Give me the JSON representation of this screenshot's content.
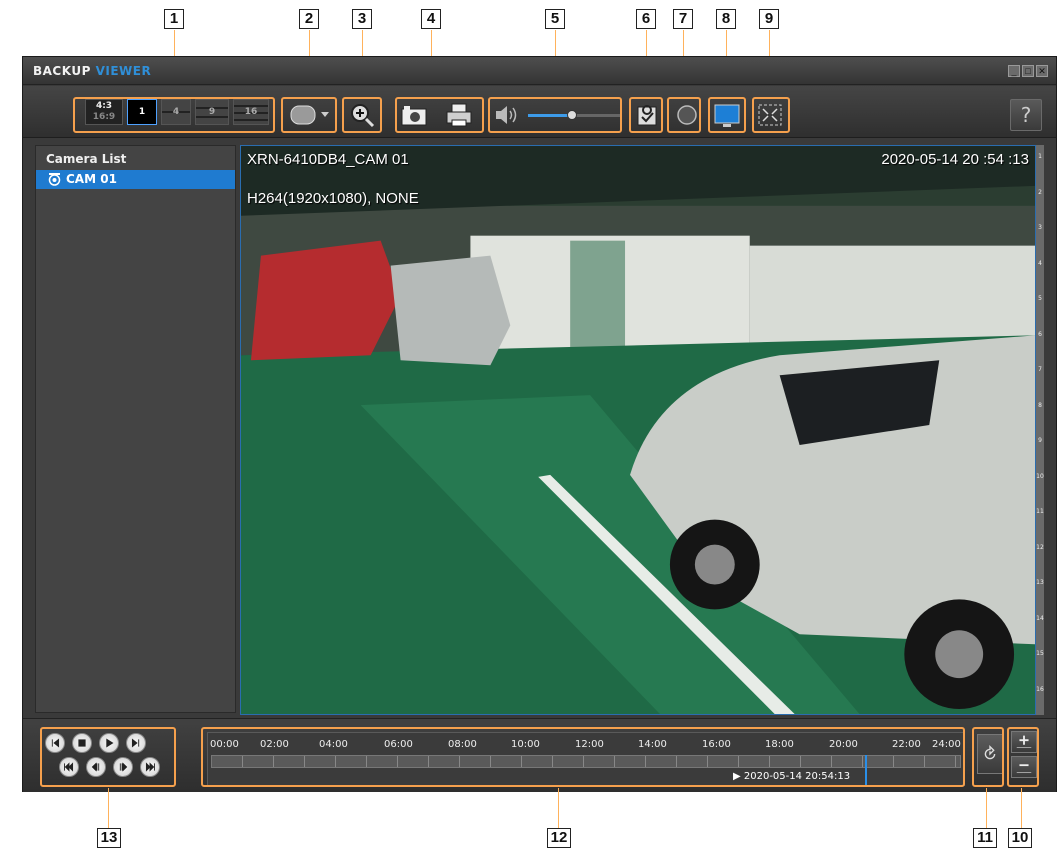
{
  "callouts": [
    "1",
    "2",
    "3",
    "4",
    "5",
    "6",
    "7",
    "8",
    "9",
    "10",
    "11",
    "12",
    "13"
  ],
  "app": {
    "title_main": "BACKUP",
    "title_accent": "VIEWER",
    "window_buttons": [
      "_",
      "□",
      "✕"
    ]
  },
  "toolbar": {
    "ratio_43": "4:3",
    "ratio_169": "16:9",
    "split_1": "1",
    "split_4": "4",
    "split_9": "9",
    "split_16": "16",
    "help_label": "?",
    "volume_level": 0.45
  },
  "camera_list": {
    "title": "Camera List",
    "items": [
      {
        "label": "CAM 01",
        "selected": true
      }
    ]
  },
  "video": {
    "camera_name": "XRN-6410DB4_CAM 01",
    "timestamp": "2020-05-14 20 :54 :13",
    "codec_info": "H264(1920x1080), NONE"
  },
  "channel_strip": [
    "1",
    "2",
    "3",
    "4",
    "5",
    "6",
    "7",
    "8",
    "9",
    "10",
    "11",
    "12",
    "13",
    "14",
    "15",
    "16"
  ],
  "timeline": {
    "hours": [
      "00:00",
      "02:00",
      "04:00",
      "06:00",
      "08:00",
      "10:00",
      "12:00",
      "14:00",
      "16:00",
      "18:00",
      "20:00",
      "22:00",
      "24:00"
    ],
    "current_time": "▶ 2020-05-14 20:54:13"
  },
  "colors": {
    "accent": "#2f8fd8",
    "selection": "#1f7bd0",
    "callout_line": "#f5a04d",
    "panel": "#3a3a3a"
  }
}
